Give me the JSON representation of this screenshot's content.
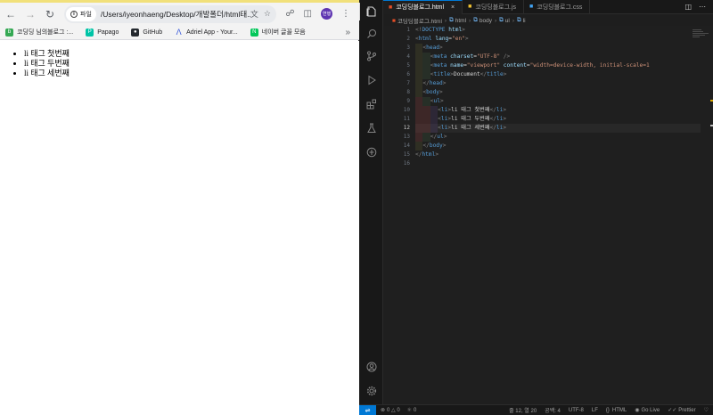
{
  "browser": {
    "url": "/Users/iyeonhaeng/Desktop/개발폴더/html태...",
    "chip_label": "파일",
    "avatar_label": "연행",
    "bookmarks": [
      {
        "label": "코딩딩 님의블로그 :...",
        "color": "#34a853"
      },
      {
        "label": "Papago",
        "color": "#00c4a7"
      },
      {
        "label": "GitHub",
        "color": "#24292f"
      },
      {
        "label": "Adriel App - Your...",
        "color": "#3b5bdb"
      },
      {
        "label": "네이버 글꼴 모음",
        "color": "#03c75a"
      }
    ],
    "list_items": [
      "li 태그 첫번째",
      "li 태그 두번째",
      "li 태그 세번째"
    ]
  },
  "editor": {
    "tabs": [
      {
        "label": "코딩딩블로그.html",
        "icon_color": "#e44d26",
        "active": true
      },
      {
        "label": "코딩딩블로그.js",
        "icon_color": "#f1c232",
        "active": false
      },
      {
        "label": "코딩딩블로그.css",
        "icon_color": "#42a5f5",
        "active": false
      }
    ],
    "breadcrumb": [
      "코딩딩블로그.html",
      "html",
      "body",
      "ul",
      "li"
    ],
    "line_numbers": [
      "1",
      "2",
      "3",
      "4",
      "5",
      "6",
      "7",
      "8",
      "9",
      "10",
      "11",
      "12",
      "13",
      "14",
      "15",
      "16"
    ],
    "current_line": 12
  },
  "statusbar": {
    "problems": "0 △ 0",
    "ports": "0",
    "position": "줄 12, 열 20",
    "spaces": "공백: 4",
    "encoding": "UTF-8",
    "eol": "LF",
    "language": "HTML",
    "golive": "Go Live",
    "prettier": "Prettier"
  },
  "colors": {
    "accent": "#0078d4",
    "tag": "#569cd6",
    "attribute": "#9cdcfe",
    "string": "#ce9178"
  }
}
